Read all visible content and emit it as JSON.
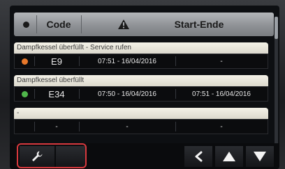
{
  "header": {
    "code_label": "Code",
    "start_end_label": "Start-Ende",
    "icons": [
      "status-dot-icon",
      "warning-triangle-icon"
    ]
  },
  "alarms": [
    {
      "title": "Dampfkessel überfüllt - Service rufen",
      "status_color": "#e8782a",
      "code": "E9",
      "start": "07:51 - 16/04/2016",
      "end": "-"
    },
    {
      "title": "Dampfkessel überfüllt",
      "status_color": "#4fb64a",
      "code": "E34",
      "start": "07:50 - 16/04/2016",
      "end": "07:51 - 16/04/2016"
    },
    {
      "title": "-",
      "status_color": null,
      "code": "-",
      "start": "-",
      "end": "-"
    }
  ],
  "footer": {
    "buttons": [
      "wrench-icon",
      "back-arrow-icon",
      "up-arrow-icon",
      "down-arrow-icon"
    ],
    "highlight_color": "#d8393e"
  }
}
